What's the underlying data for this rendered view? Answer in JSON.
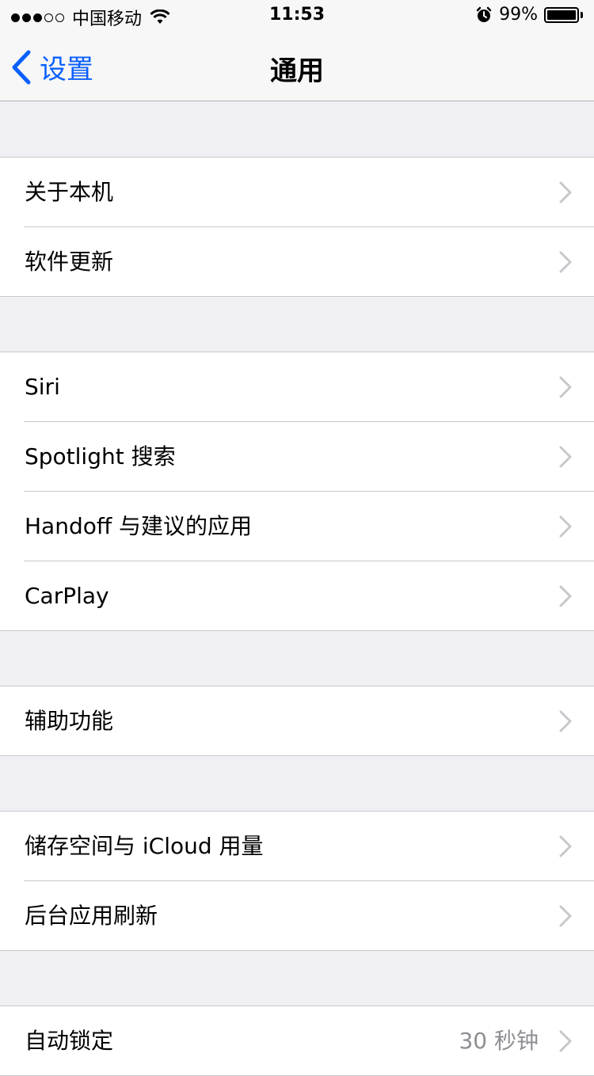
{
  "status_bar": {
    "carrier": "中国移动",
    "time": "11:53",
    "battery_percent": "99%",
    "battery_level": 0.99,
    "signal_strength": 3,
    "signal_max": 5
  },
  "nav": {
    "back_label": "设置",
    "title": "通用"
  },
  "groups": [
    {
      "rows": [
        {
          "label": "关于本机"
        },
        {
          "label": "软件更新"
        }
      ]
    },
    {
      "rows": [
        {
          "label": "Siri"
        },
        {
          "label": "Spotlight 搜索"
        },
        {
          "label": "Handoff 与建议的应用"
        },
        {
          "label": "CarPlay"
        }
      ]
    },
    {
      "rows": [
        {
          "label": "辅助功能"
        }
      ]
    },
    {
      "rows": [
        {
          "label": "储存空间与 iCloud 用量"
        },
        {
          "label": "后台应用刷新"
        }
      ]
    },
    {
      "rows": [
        {
          "label": "自动锁定",
          "value": "30 秒钟"
        }
      ]
    }
  ],
  "colors": {
    "accent": "#0a60fe",
    "background": "#efeff4",
    "chevron": "#c7c7cc",
    "separator": "#c8c7cc"
  }
}
